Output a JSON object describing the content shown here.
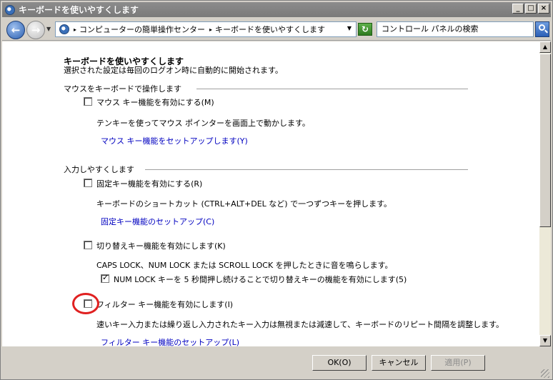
{
  "window": {
    "title": "キーボードを使いやすくします",
    "minimize": "_",
    "maximize": "□",
    "close": "×"
  },
  "address": {
    "separator": "▸",
    "breadcrumb": [
      "コンピューターの簡単操作センター",
      "キーボードを使いやすくします"
    ],
    "search_placeholder": "コントロール パネルの検索"
  },
  "page": {
    "title": "キーボードを使いやすくします",
    "subtitle": "選択された設定は毎回のログオン時に自動的に開始されます。",
    "sections": [
      {
        "title": "マウスをキーボードで操作します",
        "items": [
          {
            "checkbox_label": "マウス キー機能を有効にする(M)",
            "checked": false,
            "description": "テンキーを使ってマウス ポインターを画面上で動かします。",
            "link": "マウス キー機能をセットアップします(Y)"
          }
        ]
      },
      {
        "title": "入力しやすくします",
        "items": [
          {
            "checkbox_label": "固定キー機能を有効にする(R)",
            "checked": false,
            "description": "キーボードのショートカット (CTRL+ALT+DEL など) で一つずつキーを押します。",
            "link": "固定キー機能のセットアップ(C)"
          },
          {
            "checkbox_label": "切り替えキー機能を有効にします(K)",
            "checked": false,
            "description": "CAPS LOCK、NUM LOCK または SCROLL LOCK を押したときに音を鳴らします。",
            "sub_checkbox_label": "NUM LOCK キーを 5 秒間押し続けることで切り替えキーの機能を有効にします(5)",
            "sub_checked": true
          },
          {
            "checkbox_label": "フィルター キー機能を有効にします(I)",
            "checked": false,
            "description": "速いキー入力または繰り返し入力されたキー入力は無視または減速して、キーボードのリピート間隔を調整します。",
            "link": "フィルター キー機能のセットアップ(L)"
          }
        ]
      }
    ]
  },
  "footer": {
    "ok": "OK(O)",
    "cancel": "キャンセル",
    "apply": "適用(P)"
  },
  "colors": {
    "link": "#0000c0",
    "highlight_circle": "#e02020"
  }
}
